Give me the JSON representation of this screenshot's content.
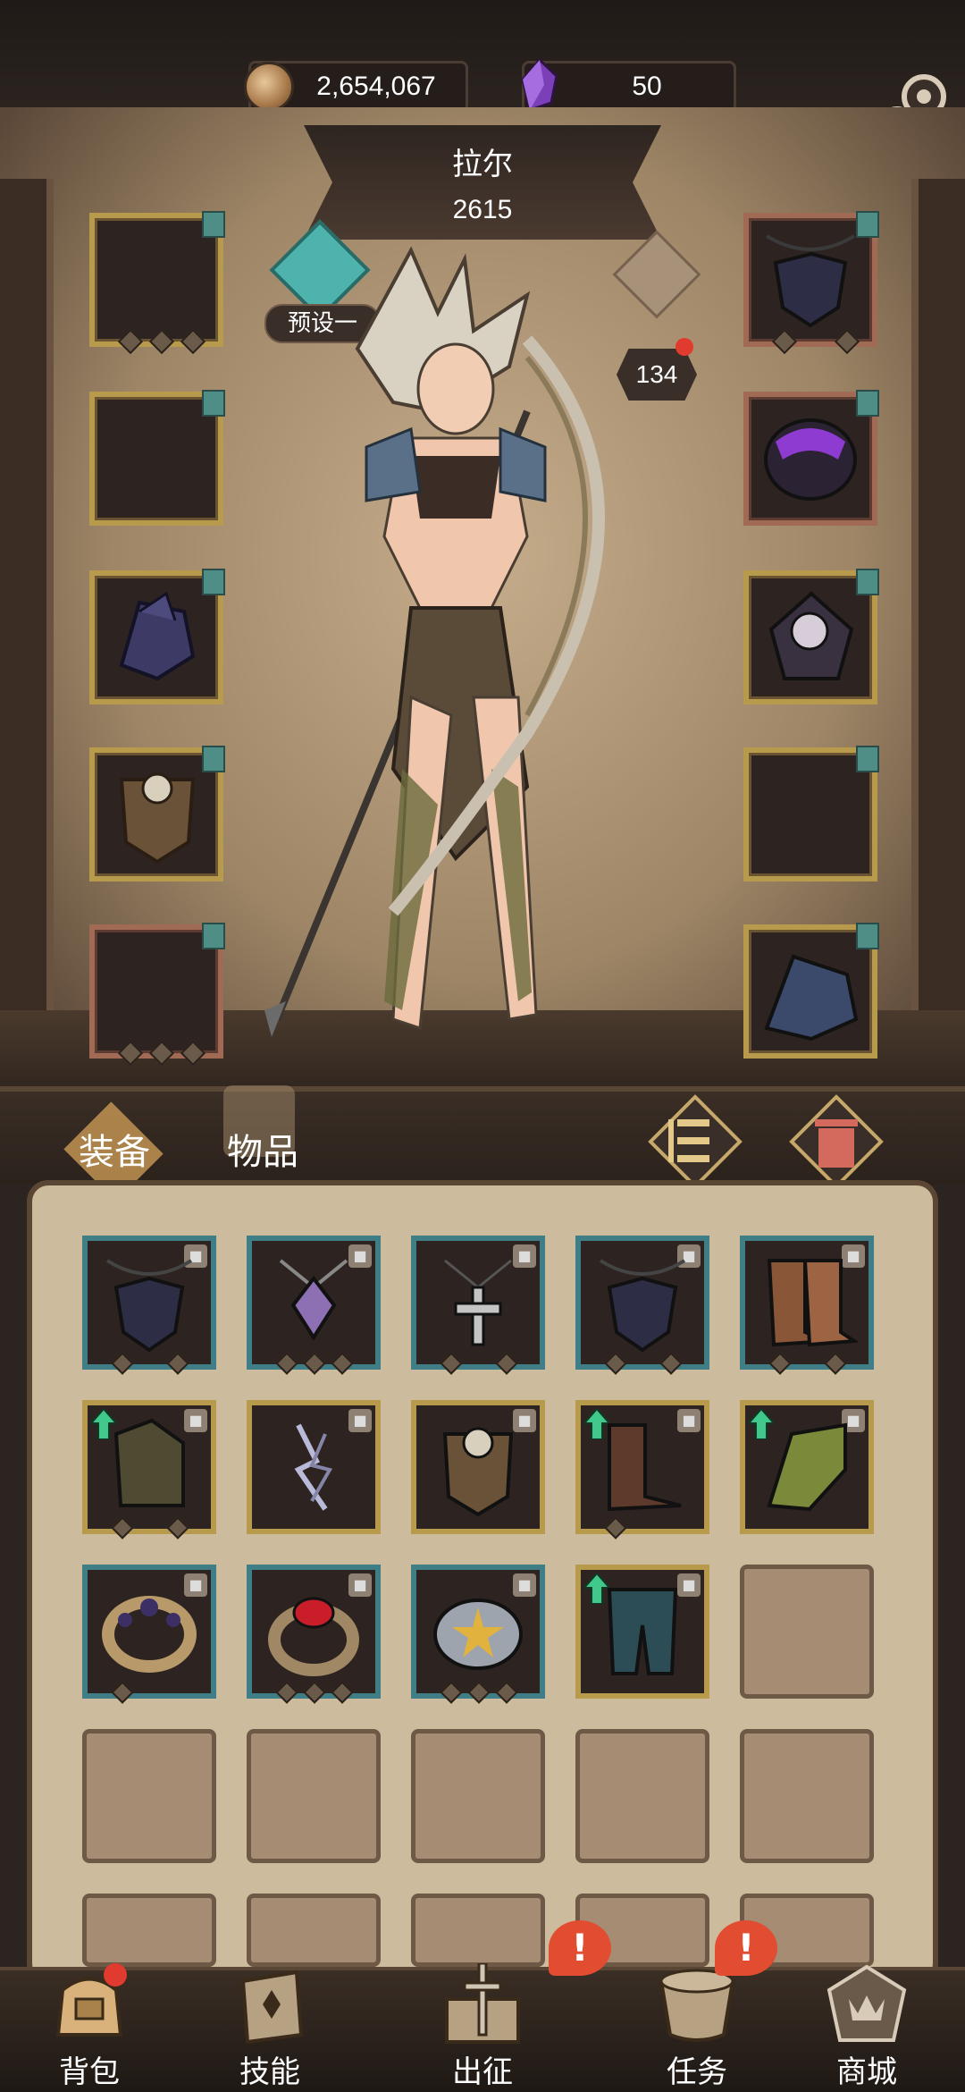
{
  "currency": {
    "gold": "2,654,067",
    "gems": "50"
  },
  "hero": {
    "name": "拉尔",
    "power": "2615",
    "level": "134",
    "preset": "预设一"
  },
  "tabs": {
    "equipment": "装备",
    "items": "物品"
  },
  "icons": {
    "settings": "gear-icon",
    "gold": "coin-icon",
    "gems": "purple-crystal-icon",
    "sort": "sort-icon",
    "trash": "trash-icon",
    "lock": "lock-icon",
    "upgrade": "upgrade-arrow-icon"
  },
  "nav": [
    "背包",
    "技能",
    "出征",
    "任务",
    "商城"
  ],
  "nav_alerts": {
    "expedition": "!",
    "quests": "!"
  },
  "colors": {
    "gold_frame": "#b89a4c",
    "blue_frame": "#3f7d87",
    "red_frame": "#a06a55",
    "alert": "#e24c31"
  }
}
